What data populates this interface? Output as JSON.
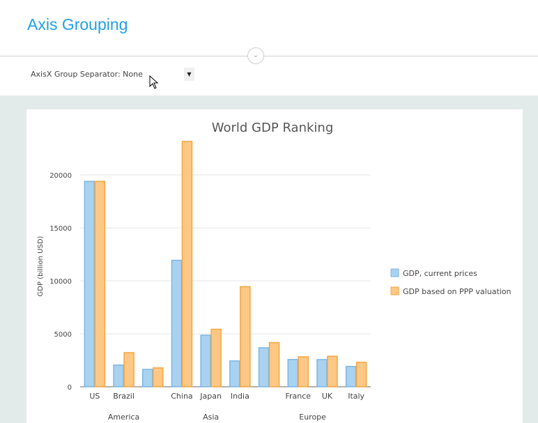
{
  "page": {
    "title": "Axis Grouping",
    "group_separator_label": "AxisX Group Separator: None"
  },
  "chart_data": {
    "type": "bar",
    "title": "World GDP Ranking",
    "xlabel": "",
    "ylabel": "GDP (billion USD)",
    "ylim": [
      0,
      20000
    ],
    "yticks": [
      0,
      5000,
      10000,
      15000,
      20000
    ],
    "grid": true,
    "legend_position": "right",
    "categories": [
      "US",
      "Brazil",
      "",
      "China",
      "Japan",
      "India",
      "",
      "France",
      "UK",
      "Italy"
    ],
    "groups": [
      {
        "name": "America",
        "span": 3
      },
      {
        "name": "Asia",
        "span": 3
      },
      {
        "name": "Europe",
        "span": 4
      }
    ],
    "series": [
      {
        "name": "GDP, current prices",
        "color": "#a9d2f1",
        "values": [
          19390,
          2050,
          1640,
          11940,
          4870,
          2440,
          3680,
          2580,
          2570,
          1920
        ]
      },
      {
        "name": "GDP based on PPP valuation",
        "color": "#fdc885",
        "values": [
          19390,
          3220,
          1780,
          23160,
          5430,
          9450,
          4170,
          2830,
          2880,
          2310
        ]
      }
    ]
  }
}
